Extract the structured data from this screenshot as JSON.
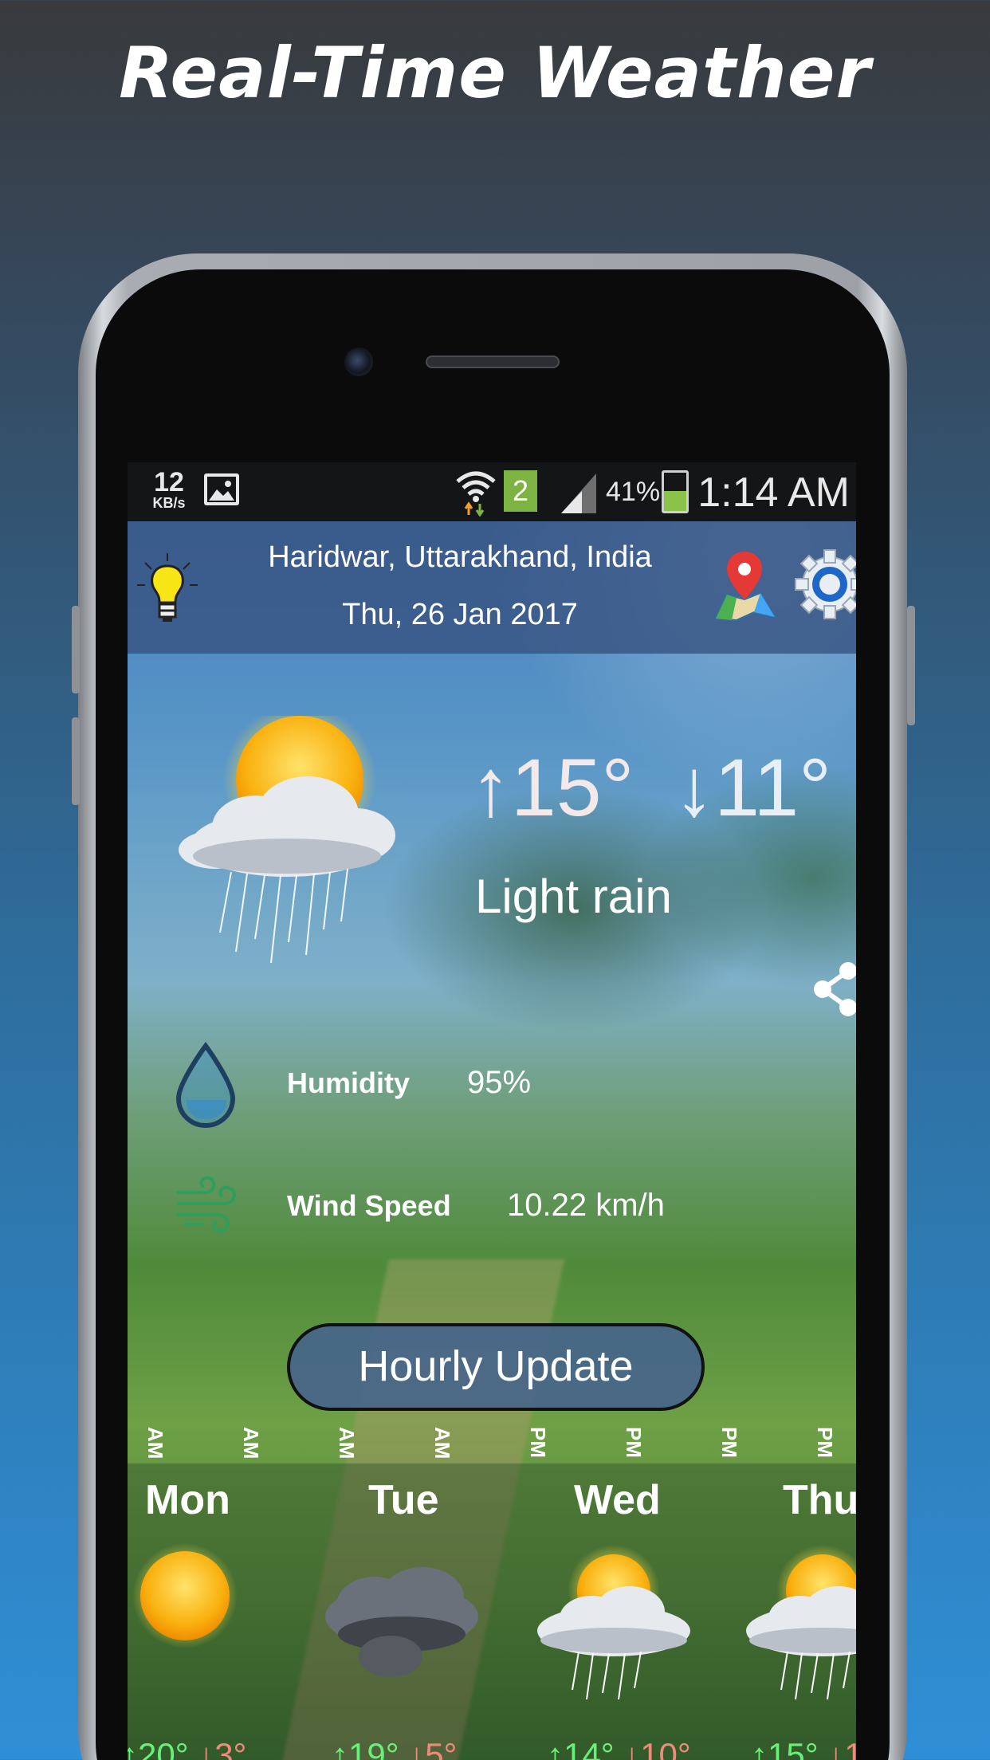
{
  "promo": {
    "title": "Real-Time Weather"
  },
  "status_bar": {
    "net_speed": "12",
    "net_unit": "KB/s",
    "sim_slot": "2",
    "battery": "41%",
    "time": "1:14 AM"
  },
  "header": {
    "location": "Haridwar, Uttarakhand, India",
    "date": "Thu, 26 Jan 2017",
    "icons": [
      "lightbulb-icon",
      "map-pin-icon",
      "settings-gear-icon"
    ]
  },
  "current": {
    "high": "↑15°",
    "low": "↓11°",
    "condition": "Light rain",
    "humidity_label": "Humidity",
    "humidity_value": "95%",
    "wind_label": "Wind Speed",
    "wind_value": "10.22 km/h"
  },
  "hourly_button": "Hourly Update",
  "hourly_ticks": [
    "AM",
    "AM",
    "AM",
    "AM",
    "PM",
    "PM",
    "PM",
    "PM"
  ],
  "forecast": [
    {
      "day": "Mon",
      "high": "↑20°",
      "low": "↓3°",
      "icon": "sunny-icon"
    },
    {
      "day": "Tue",
      "high": "↑19°",
      "low": "↓5°",
      "icon": "storm-cloud-icon"
    },
    {
      "day": "Wed",
      "high": "↑14°",
      "low": "↓10°",
      "icon": "sun-rain-icon"
    },
    {
      "day": "Thu",
      "high": "↑15°",
      "low": "↓1",
      "icon": "sun-rain-icon"
    }
  ],
  "colors": {
    "temp_high": "#69f07a",
    "temp_low": "#f08a7c",
    "header_bg": "#385482"
  }
}
